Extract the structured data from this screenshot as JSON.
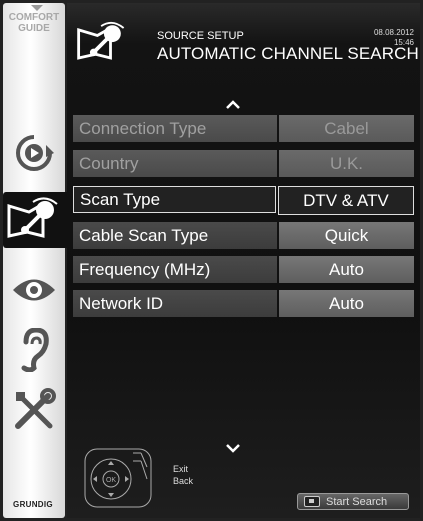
{
  "sidebar": {
    "title_line1": "COMFORT",
    "title_line2": "GUIDE",
    "brand": "GRUNDIG",
    "items": [
      {
        "icon": "playback-icon"
      },
      {
        "icon": "source-setup-icon",
        "active": true
      },
      {
        "icon": "picture-eye-icon"
      },
      {
        "icon": "sound-ear-icon"
      },
      {
        "icon": "tools-icon"
      }
    ]
  },
  "header": {
    "subtitle": "SOURCE SETUP",
    "title": "AUTOMATIC CHANNEL SEARCH",
    "date": "08.08.2012",
    "time": "15:46"
  },
  "settings": [
    {
      "label": "Connection Type",
      "value": "Cabel",
      "state": "dim"
    },
    {
      "label": "Country",
      "value": "U.K.",
      "state": "dim"
    },
    {
      "label": "Scan Type",
      "value": "DTV & ATV",
      "state": "selected"
    },
    {
      "label": "Cable Scan Type",
      "value": "Quick",
      "state": "normal"
    },
    {
      "label": "Frequency (MHz)",
      "value": "Auto",
      "state": "normal"
    },
    {
      "label": "Network ID",
      "value": "Auto",
      "state": "normal"
    }
  ],
  "footer": {
    "remote_ok": "OK",
    "exit_label": "Exit",
    "back_label": "Back",
    "start_label": "Start Search"
  },
  "colors": {
    "background": "#101010",
    "sidebar": "#ffffff",
    "row_dim": "#5a5a5a",
    "row_value": "#6a6a6a",
    "selected_border": "#dddddd"
  }
}
